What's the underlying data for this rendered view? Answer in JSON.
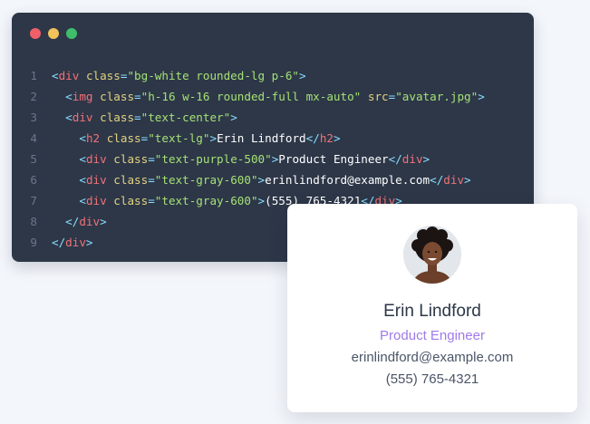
{
  "editor": {
    "colors": {
      "background": "#2d3748",
      "tag": "#f07178",
      "attribute": "#e3d27f",
      "string": "#a5e075",
      "punctuation": "#89ddff",
      "text": "#ffffff",
      "line_number": "#6b7689"
    },
    "window_controls": [
      {
        "name": "close",
        "color": "#f0606a"
      },
      {
        "name": "minimize",
        "color": "#f2c35b"
      },
      {
        "name": "maximize",
        "color": "#3fbd6b"
      }
    ],
    "lines": [
      {
        "n": "1",
        "tokens": [
          {
            "k": "p",
            "v": "<"
          },
          {
            "k": "t",
            "v": "div"
          },
          {
            "k": "x",
            "v": " "
          },
          {
            "k": "a",
            "v": "class"
          },
          {
            "k": "p",
            "v": "="
          },
          {
            "k": "s",
            "v": "\"bg-white rounded-lg p-6\""
          },
          {
            "k": "p",
            "v": ">"
          }
        ]
      },
      {
        "n": "2",
        "tokens": [
          {
            "k": "x",
            "v": "  "
          },
          {
            "k": "p",
            "v": "<"
          },
          {
            "k": "t",
            "v": "img"
          },
          {
            "k": "x",
            "v": " "
          },
          {
            "k": "a",
            "v": "class"
          },
          {
            "k": "p",
            "v": "="
          },
          {
            "k": "s",
            "v": "\"h-16 w-16 rounded-full mx-auto\""
          },
          {
            "k": "x",
            "v": " "
          },
          {
            "k": "a",
            "v": "src"
          },
          {
            "k": "p",
            "v": "="
          },
          {
            "k": "s",
            "v": "\"avatar.jpg\""
          },
          {
            "k": "p",
            "v": ">"
          }
        ]
      },
      {
        "n": "3",
        "tokens": [
          {
            "k": "x",
            "v": "  "
          },
          {
            "k": "p",
            "v": "<"
          },
          {
            "k": "t",
            "v": "div"
          },
          {
            "k": "x",
            "v": " "
          },
          {
            "k": "a",
            "v": "class"
          },
          {
            "k": "p",
            "v": "="
          },
          {
            "k": "s",
            "v": "\"text-center\""
          },
          {
            "k": "p",
            "v": ">"
          }
        ]
      },
      {
        "n": "4",
        "tokens": [
          {
            "k": "x",
            "v": "    "
          },
          {
            "k": "p",
            "v": "<"
          },
          {
            "k": "t",
            "v": "h2"
          },
          {
            "k": "x",
            "v": " "
          },
          {
            "k": "a",
            "v": "class"
          },
          {
            "k": "p",
            "v": "="
          },
          {
            "k": "s",
            "v": "\"text-lg\""
          },
          {
            "k": "p",
            "v": ">"
          },
          {
            "k": "x",
            "v": "Erin Lindford"
          },
          {
            "k": "p",
            "v": "</"
          },
          {
            "k": "t",
            "v": "h2"
          },
          {
            "k": "p",
            "v": ">"
          }
        ]
      },
      {
        "n": "5",
        "tokens": [
          {
            "k": "x",
            "v": "    "
          },
          {
            "k": "p",
            "v": "<"
          },
          {
            "k": "t",
            "v": "div"
          },
          {
            "k": "x",
            "v": " "
          },
          {
            "k": "a",
            "v": "class"
          },
          {
            "k": "p",
            "v": "="
          },
          {
            "k": "s",
            "v": "\"text-purple-500\""
          },
          {
            "k": "p",
            "v": ">"
          },
          {
            "k": "x",
            "v": "Product Engineer"
          },
          {
            "k": "p",
            "v": "</"
          },
          {
            "k": "t",
            "v": "div"
          },
          {
            "k": "p",
            "v": ">"
          }
        ]
      },
      {
        "n": "6",
        "tokens": [
          {
            "k": "x",
            "v": "    "
          },
          {
            "k": "p",
            "v": "<"
          },
          {
            "k": "t",
            "v": "div"
          },
          {
            "k": "x",
            "v": " "
          },
          {
            "k": "a",
            "v": "class"
          },
          {
            "k": "p",
            "v": "="
          },
          {
            "k": "s",
            "v": "\"text-gray-600\""
          },
          {
            "k": "p",
            "v": ">"
          },
          {
            "k": "x",
            "v": "erinlindford@example.com"
          },
          {
            "k": "p",
            "v": "</"
          },
          {
            "k": "t",
            "v": "div"
          },
          {
            "k": "p",
            "v": ">"
          }
        ]
      },
      {
        "n": "7",
        "tokens": [
          {
            "k": "x",
            "v": "    "
          },
          {
            "k": "p",
            "v": "<"
          },
          {
            "k": "t",
            "v": "div"
          },
          {
            "k": "x",
            "v": " "
          },
          {
            "k": "a",
            "v": "class"
          },
          {
            "k": "p",
            "v": "="
          },
          {
            "k": "s",
            "v": "\"text-gray-600\""
          },
          {
            "k": "p",
            "v": ">"
          },
          {
            "k": "x",
            "v": "(555) 765-4321"
          },
          {
            "k": "p",
            "v": "</"
          },
          {
            "k": "t",
            "v": "div"
          },
          {
            "k": "p",
            "v": ">"
          }
        ]
      },
      {
        "n": "8",
        "tokens": [
          {
            "k": "x",
            "v": "  "
          },
          {
            "k": "p",
            "v": "</"
          },
          {
            "k": "t",
            "v": "div"
          },
          {
            "k": "p",
            "v": ">"
          }
        ]
      },
      {
        "n": "9",
        "tokens": [
          {
            "k": "p",
            "v": "</"
          },
          {
            "k": "t",
            "v": "div"
          },
          {
            "k": "p",
            "v": ">"
          }
        ]
      }
    ]
  },
  "card": {
    "avatar_icon": "person-avatar",
    "name": "Erin Lindford",
    "role": "Product Engineer",
    "email": "erinlindford@example.com",
    "phone": "(555) 765-4321",
    "colors": {
      "name": "#2d3748",
      "role": "#9f7aea",
      "detail": "#4a5568"
    }
  }
}
